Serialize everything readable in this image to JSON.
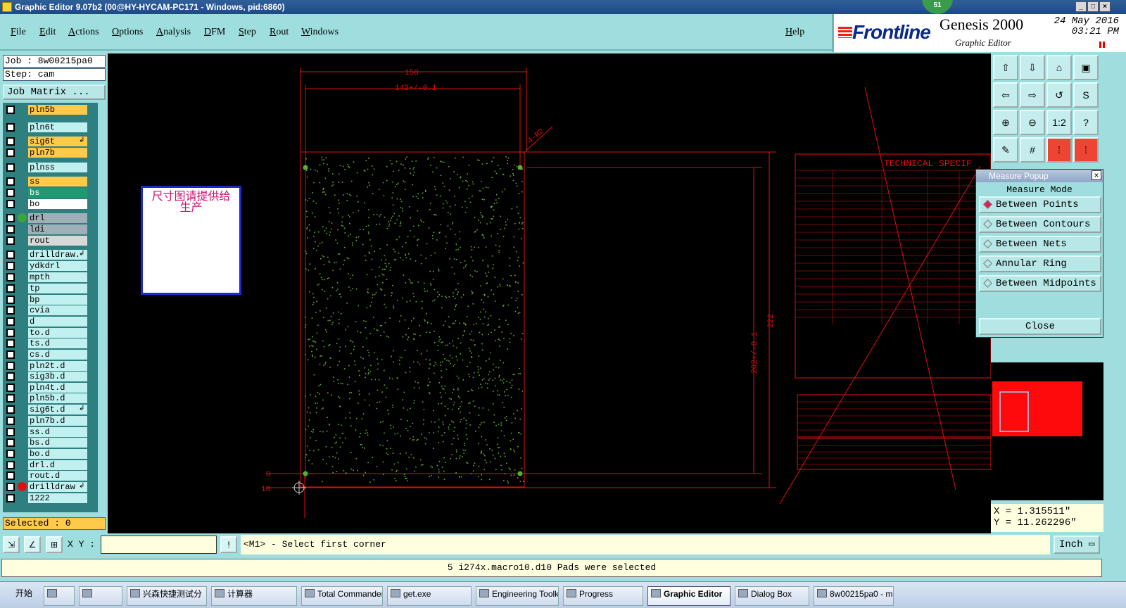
{
  "window": {
    "title": "Graphic Editor 9.07b2 (00@HY-HYCAM-PC171 - Windows, pid:6860)",
    "badge": "51",
    "controls": [
      "_",
      "□",
      "×"
    ]
  },
  "menu": {
    "items": [
      "File",
      "Edit",
      "Actions",
      "Options",
      "Analysis",
      "DFM",
      "Step",
      "Rout",
      "Windows"
    ],
    "help": "Help"
  },
  "brand": {
    "logo": "Frontline",
    "product": "Genesis 2000",
    "subtitle": "Graphic Editor",
    "date": "24 May 2016",
    "time": "03:21 PM"
  },
  "job": {
    "job_label": "Job : 8w00215pa0",
    "step_label": "Step: cam",
    "matrix_button": "Job Matrix ..."
  },
  "layers": [
    {
      "name": "pln5b",
      "bg": "#ffc94a",
      "mark": ""
    },
    {
      "name": "pln6t",
      "bg": "#c0f0f0",
      "mark": ""
    },
    {
      "name": "sig6t",
      "bg": "#ffc94a",
      "mark": "↲"
    },
    {
      "name": "pln7b",
      "bg": "#ffc94a",
      "mark": ""
    },
    {
      "name": "plnss",
      "bg": "#c0f0f0",
      "mark": ""
    },
    {
      "name": "ss",
      "bg": "#ffc94a",
      "mark": ""
    },
    {
      "name": "bs",
      "bg": "#1f9a70",
      "mark": ""
    },
    {
      "name": "bo",
      "bg": "#ffffff",
      "mark": ""
    },
    {
      "name": "drl",
      "bg": "#9fb0b8",
      "mark": "",
      "dot": "#3aa33a"
    },
    {
      "name": "ldi",
      "bg": "#9fb0b8",
      "mark": ""
    },
    {
      "name": "rout",
      "bg": "#d8d8d8",
      "mark": ""
    },
    {
      "name": "drilldraw.",
      "bg": "#c0f0f0",
      "mark": "↲"
    },
    {
      "name": "ydkdrl",
      "bg": "#c0f0f0",
      "mark": ""
    },
    {
      "name": "mpth",
      "bg": "#c0f0f0",
      "mark": ""
    },
    {
      "name": "tp",
      "bg": "#c0f0f0",
      "mark": ""
    },
    {
      "name": "bp",
      "bg": "#c0f0f0",
      "mark": ""
    },
    {
      "name": "cvia",
      "bg": "#c0f0f0",
      "mark": ""
    },
    {
      "name": "d",
      "bg": "#c0f0f0",
      "mark": ""
    },
    {
      "name": "to.d",
      "bg": "#c0f0f0",
      "mark": ""
    },
    {
      "name": "ts.d",
      "bg": "#c0f0f0",
      "mark": ""
    },
    {
      "name": "cs.d",
      "bg": "#c0f0f0",
      "mark": ""
    },
    {
      "name": "pln2t.d",
      "bg": "#c0f0f0",
      "mark": ""
    },
    {
      "name": "sig3b.d",
      "bg": "#c0f0f0",
      "mark": ""
    },
    {
      "name": "pln4t.d",
      "bg": "#c0f0f0",
      "mark": ""
    },
    {
      "name": "pln5b.d",
      "bg": "#c0f0f0",
      "mark": ""
    },
    {
      "name": "sig6t.d",
      "bg": "#c0f0f0",
      "mark": "↲"
    },
    {
      "name": "pln7b.d",
      "bg": "#c0f0f0",
      "mark": ""
    },
    {
      "name": "ss.d",
      "bg": "#c0f0f0",
      "mark": ""
    },
    {
      "name": "bs.d",
      "bg": "#c0f0f0",
      "mark": ""
    },
    {
      "name": "bo.d",
      "bg": "#c0f0f0",
      "mark": ""
    },
    {
      "name": "drl.d",
      "bg": "#c0f0f0",
      "mark": ""
    },
    {
      "name": "rout.d",
      "bg": "#c0f0f0",
      "mark": ""
    },
    {
      "name": "drilldraw",
      "bg": "#c0f0f0",
      "mark": "↲",
      "dot": "#e01010"
    },
    {
      "name": "1222",
      "bg": "#c0f0f0",
      "mark": ""
    }
  ],
  "selected_label": "Selected : 0",
  "drawing": {
    "note_text": "尺寸图请提供给生产",
    "dim_top": "150",
    "dim_inner": "142+/-0.1",
    "dim_right_outer": "222",
    "dim_right_inner": "202+/-0.1",
    "dim_corner": "4-R2",
    "origin_zero": "0",
    "origin_ten": "10",
    "tech_title": "TECHNICAL SPECIF"
  },
  "measure_popup": {
    "title": "Measure Popup",
    "heading": "Measure Mode",
    "modes": [
      "Between Points",
      "Between Contours",
      "Between Nets",
      "Annular Ring",
      "Between Midpoints"
    ],
    "active_mode": 0,
    "close_label": "Close"
  },
  "coords": {
    "x_label": "X = 1.315511\"",
    "y_label": "Y = 11.262296\""
  },
  "bottom": {
    "xy_label": "X Y :",
    "xy_value": "",
    "prompt": "<M1> - Select first corner",
    "unit": "Inch ▭",
    "status": "5 i274x.macro10.d10 Pads were selected"
  },
  "taskbar": {
    "start": "开始",
    "items": [
      "",
      "",
      "兴森快捷测试分",
      "计算器",
      "Total Commander",
      "get.exe",
      "Engineering Toolk",
      "Progress",
      "Graphic Editor",
      "Dialog Box",
      "8w00215pa0 - m"
    ],
    "active": 8
  },
  "colors": {
    "panel": "#9fdede",
    "canvas": "#000000",
    "outline_red": "#e01010",
    "pad_green": "#5fae2e"
  }
}
